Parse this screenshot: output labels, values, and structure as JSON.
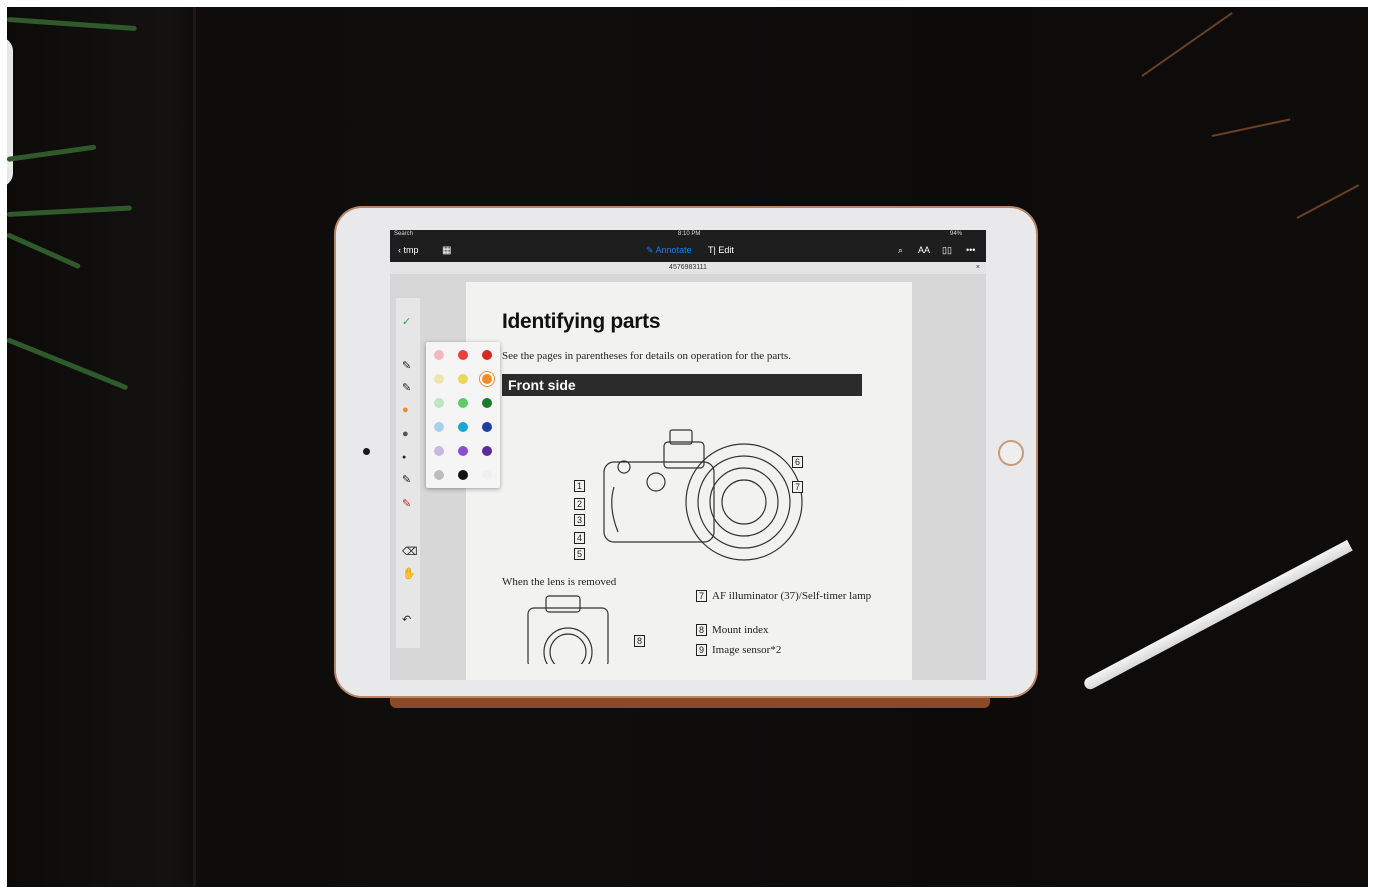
{
  "status_bar": {
    "carrier": "Search",
    "time": "8:10 PM",
    "battery": "94%"
  },
  "nav_bar": {
    "back_label": "tmp",
    "annotate_label": "Annotate",
    "edit_label": "Edit"
  },
  "document": {
    "file_name": "4576983111",
    "title": "Identifying parts",
    "intro": "See the pages in parentheses for details on operation for the parts.",
    "section": "Front side",
    "lens_caption": "When the lens is removed",
    "camera_labels": [
      "1",
      "2",
      "3",
      "4",
      "5",
      "6",
      "7"
    ],
    "lens_label": "8",
    "parts": [
      {
        "num": "7",
        "text": "AF illuminator (37)/Self-timer lamp"
      },
      {
        "num": "8",
        "text": "Mount index"
      },
      {
        "num": "9",
        "text": "Image sensor*2"
      }
    ]
  },
  "palette_colors": [
    [
      "#f2b8c0",
      "#e8403a",
      "#d42a22"
    ],
    [
      "#ede6b0",
      "#ecd75a",
      "#f08a2a"
    ],
    [
      "#bfe5c2",
      "#5ecb6a",
      "#1c7a2c"
    ],
    [
      "#a9d2ea",
      "#17a6d6",
      "#1f3fa0"
    ],
    [
      "#c8b9e2",
      "#8850d0",
      "#5a2a9a"
    ],
    [
      "#bdbdbd",
      "#111111",
      "#f0f0f0"
    ]
  ],
  "accent_color": "#1a7ef0"
}
